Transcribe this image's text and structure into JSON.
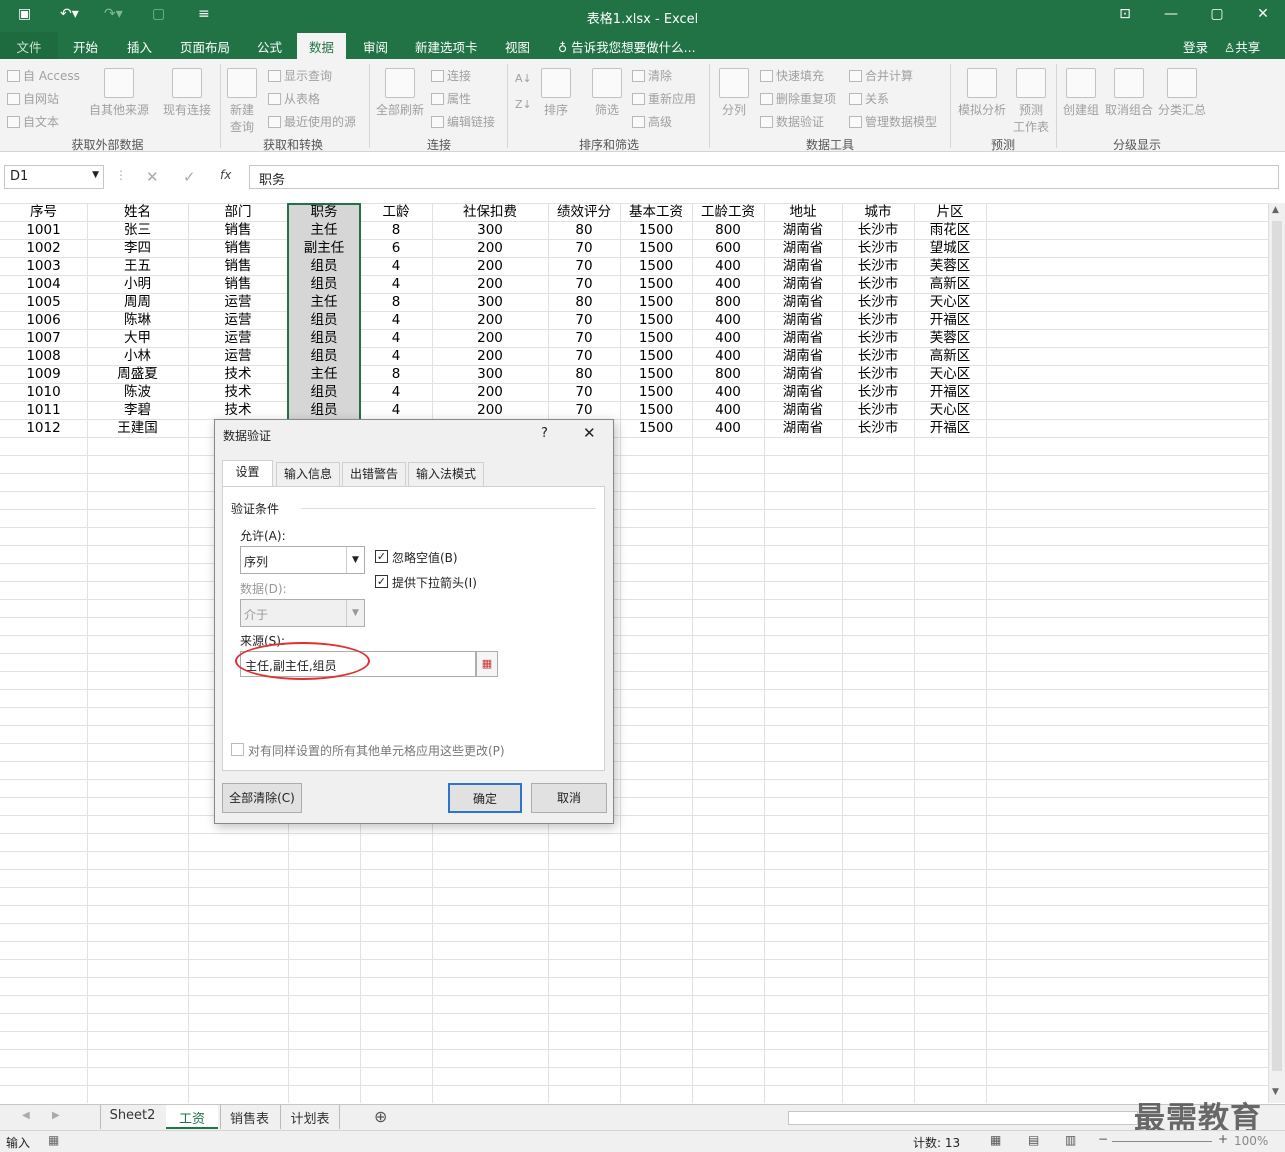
{
  "window": {
    "title": "表格1.xlsx - Excel",
    "login": "登录",
    "share": "共享"
  },
  "tabs": [
    "文件",
    "开始",
    "插入",
    "页面布局",
    "公式",
    "数据",
    "审阅",
    "新建选项卡",
    "视图"
  ],
  "tell_me": "告诉我您想要做什么...",
  "ribbon": {
    "access": "自 Access",
    "web": "自网站",
    "text": "自文本",
    "other": "自其他来源",
    "existing": "现有连接",
    "new_query": "新建",
    "new_query2": "查询",
    "show_query": "显示查询",
    "from_table": "从表格",
    "recent": "最近使用的源",
    "refresh_all": "全部刷新",
    "connections": "连接",
    "properties": "属性",
    "edit_links": "编辑链接",
    "sort": "排序",
    "filter": "筛选",
    "clear": "清除",
    "reapply": "重新应用",
    "advanced": "高级",
    "split": "分列",
    "flash_fill": "快速填充",
    "remove_dup": "删除重复项",
    "data_valid": "数据验证",
    "consolidate": "合并计算",
    "relations": "关系",
    "data_model": "管理数据模型",
    "whatif": "模拟分析",
    "forecast": "预测",
    "forecast2": "工作表",
    "group": "创建组",
    "ungroup": "取消组合",
    "subtotal": "分类汇总",
    "g_external": "获取外部数据",
    "g_transform": "获取和转换",
    "g_conn": "连接",
    "g_sort": "排序和筛选",
    "g_tools": "数据工具",
    "g_forecast": "预测",
    "g_outline": "分级显示"
  },
  "namebox": "D1",
  "formula": "职务",
  "headers": [
    "序号",
    "姓名",
    "部门",
    "职务",
    "工龄",
    "社保扣费",
    "绩效评分",
    "基本工资",
    "工龄工资",
    "地址",
    "城市",
    "片区"
  ],
  "rows": [
    [
      "1001",
      "张三",
      "销售",
      "主任",
      "8",
      "300",
      "80",
      "1500",
      "800",
      "湖南省",
      "长沙市",
      "雨花区"
    ],
    [
      "1002",
      "李四",
      "销售",
      "副主任",
      "6",
      "200",
      "70",
      "1500",
      "600",
      "湖南省",
      "长沙市",
      "望城区"
    ],
    [
      "1003",
      "王五",
      "销售",
      "组员",
      "4",
      "200",
      "70",
      "1500",
      "400",
      "湖南省",
      "长沙市",
      "芙蓉区"
    ],
    [
      "1004",
      "小明",
      "销售",
      "组员",
      "4",
      "200",
      "70",
      "1500",
      "400",
      "湖南省",
      "长沙市",
      "高新区"
    ],
    [
      "1005",
      "周周",
      "运营",
      "主任",
      "8",
      "300",
      "80",
      "1500",
      "800",
      "湖南省",
      "长沙市",
      "天心区"
    ],
    [
      "1006",
      "陈琳",
      "运营",
      "组员",
      "4",
      "200",
      "70",
      "1500",
      "400",
      "湖南省",
      "长沙市",
      "开福区"
    ],
    [
      "1007",
      "大甲",
      "运营",
      "组员",
      "4",
      "200",
      "70",
      "1500",
      "400",
      "湖南省",
      "长沙市",
      "芙蓉区"
    ],
    [
      "1008",
      "小林",
      "运营",
      "组员",
      "4",
      "200",
      "70",
      "1500",
      "400",
      "湖南省",
      "长沙市",
      "高新区"
    ],
    [
      "1009",
      "周盛夏",
      "技术",
      "主任",
      "8",
      "300",
      "80",
      "1500",
      "800",
      "湖南省",
      "长沙市",
      "天心区"
    ],
    [
      "1010",
      "陈波",
      "技术",
      "组员",
      "4",
      "200",
      "70",
      "1500",
      "400",
      "湖南省",
      "长沙市",
      "开福区"
    ],
    [
      "1011",
      "李碧",
      "技术",
      "组员",
      "4",
      "200",
      "70",
      "1500",
      "400",
      "湖南省",
      "长沙市",
      "天心区"
    ],
    [
      "1012",
      "王建国",
      "",
      "",
      "",
      "",
      "",
      "1500",
      "400",
      "湖南省",
      "长沙市",
      "开福区"
    ]
  ],
  "dialog": {
    "title": "数据验证",
    "help": "?",
    "close": "✕",
    "tabs": [
      "设置",
      "输入信息",
      "出错警告",
      "输入法模式"
    ],
    "section": "验证条件",
    "allow_label": "允许(A):",
    "allow_value": "序列",
    "ignore_blank": "忽略空值(B)",
    "dropdown": "提供下拉箭头(I)",
    "data_label": "数据(D):",
    "data_value": "介于",
    "source_label": "来源(S):",
    "source_value": "主任,副主任,组员",
    "apply_all": "对有同样设置的所有其他单元格应用这些更改(P)",
    "clear_all": "全部清除(C)",
    "ok": "确定",
    "cancel": "取消"
  },
  "sheets": [
    "Sheet2",
    "工资",
    "销售表",
    "计划表"
  ],
  "status": {
    "mode": "输入",
    "count": "计数: 13",
    "zoom": "100%"
  },
  "watermark": "最需教育",
  "colors": {
    "excel_green": "#217346",
    "highlight": "#d6d6d6",
    "annotation_red": "#e03030"
  }
}
